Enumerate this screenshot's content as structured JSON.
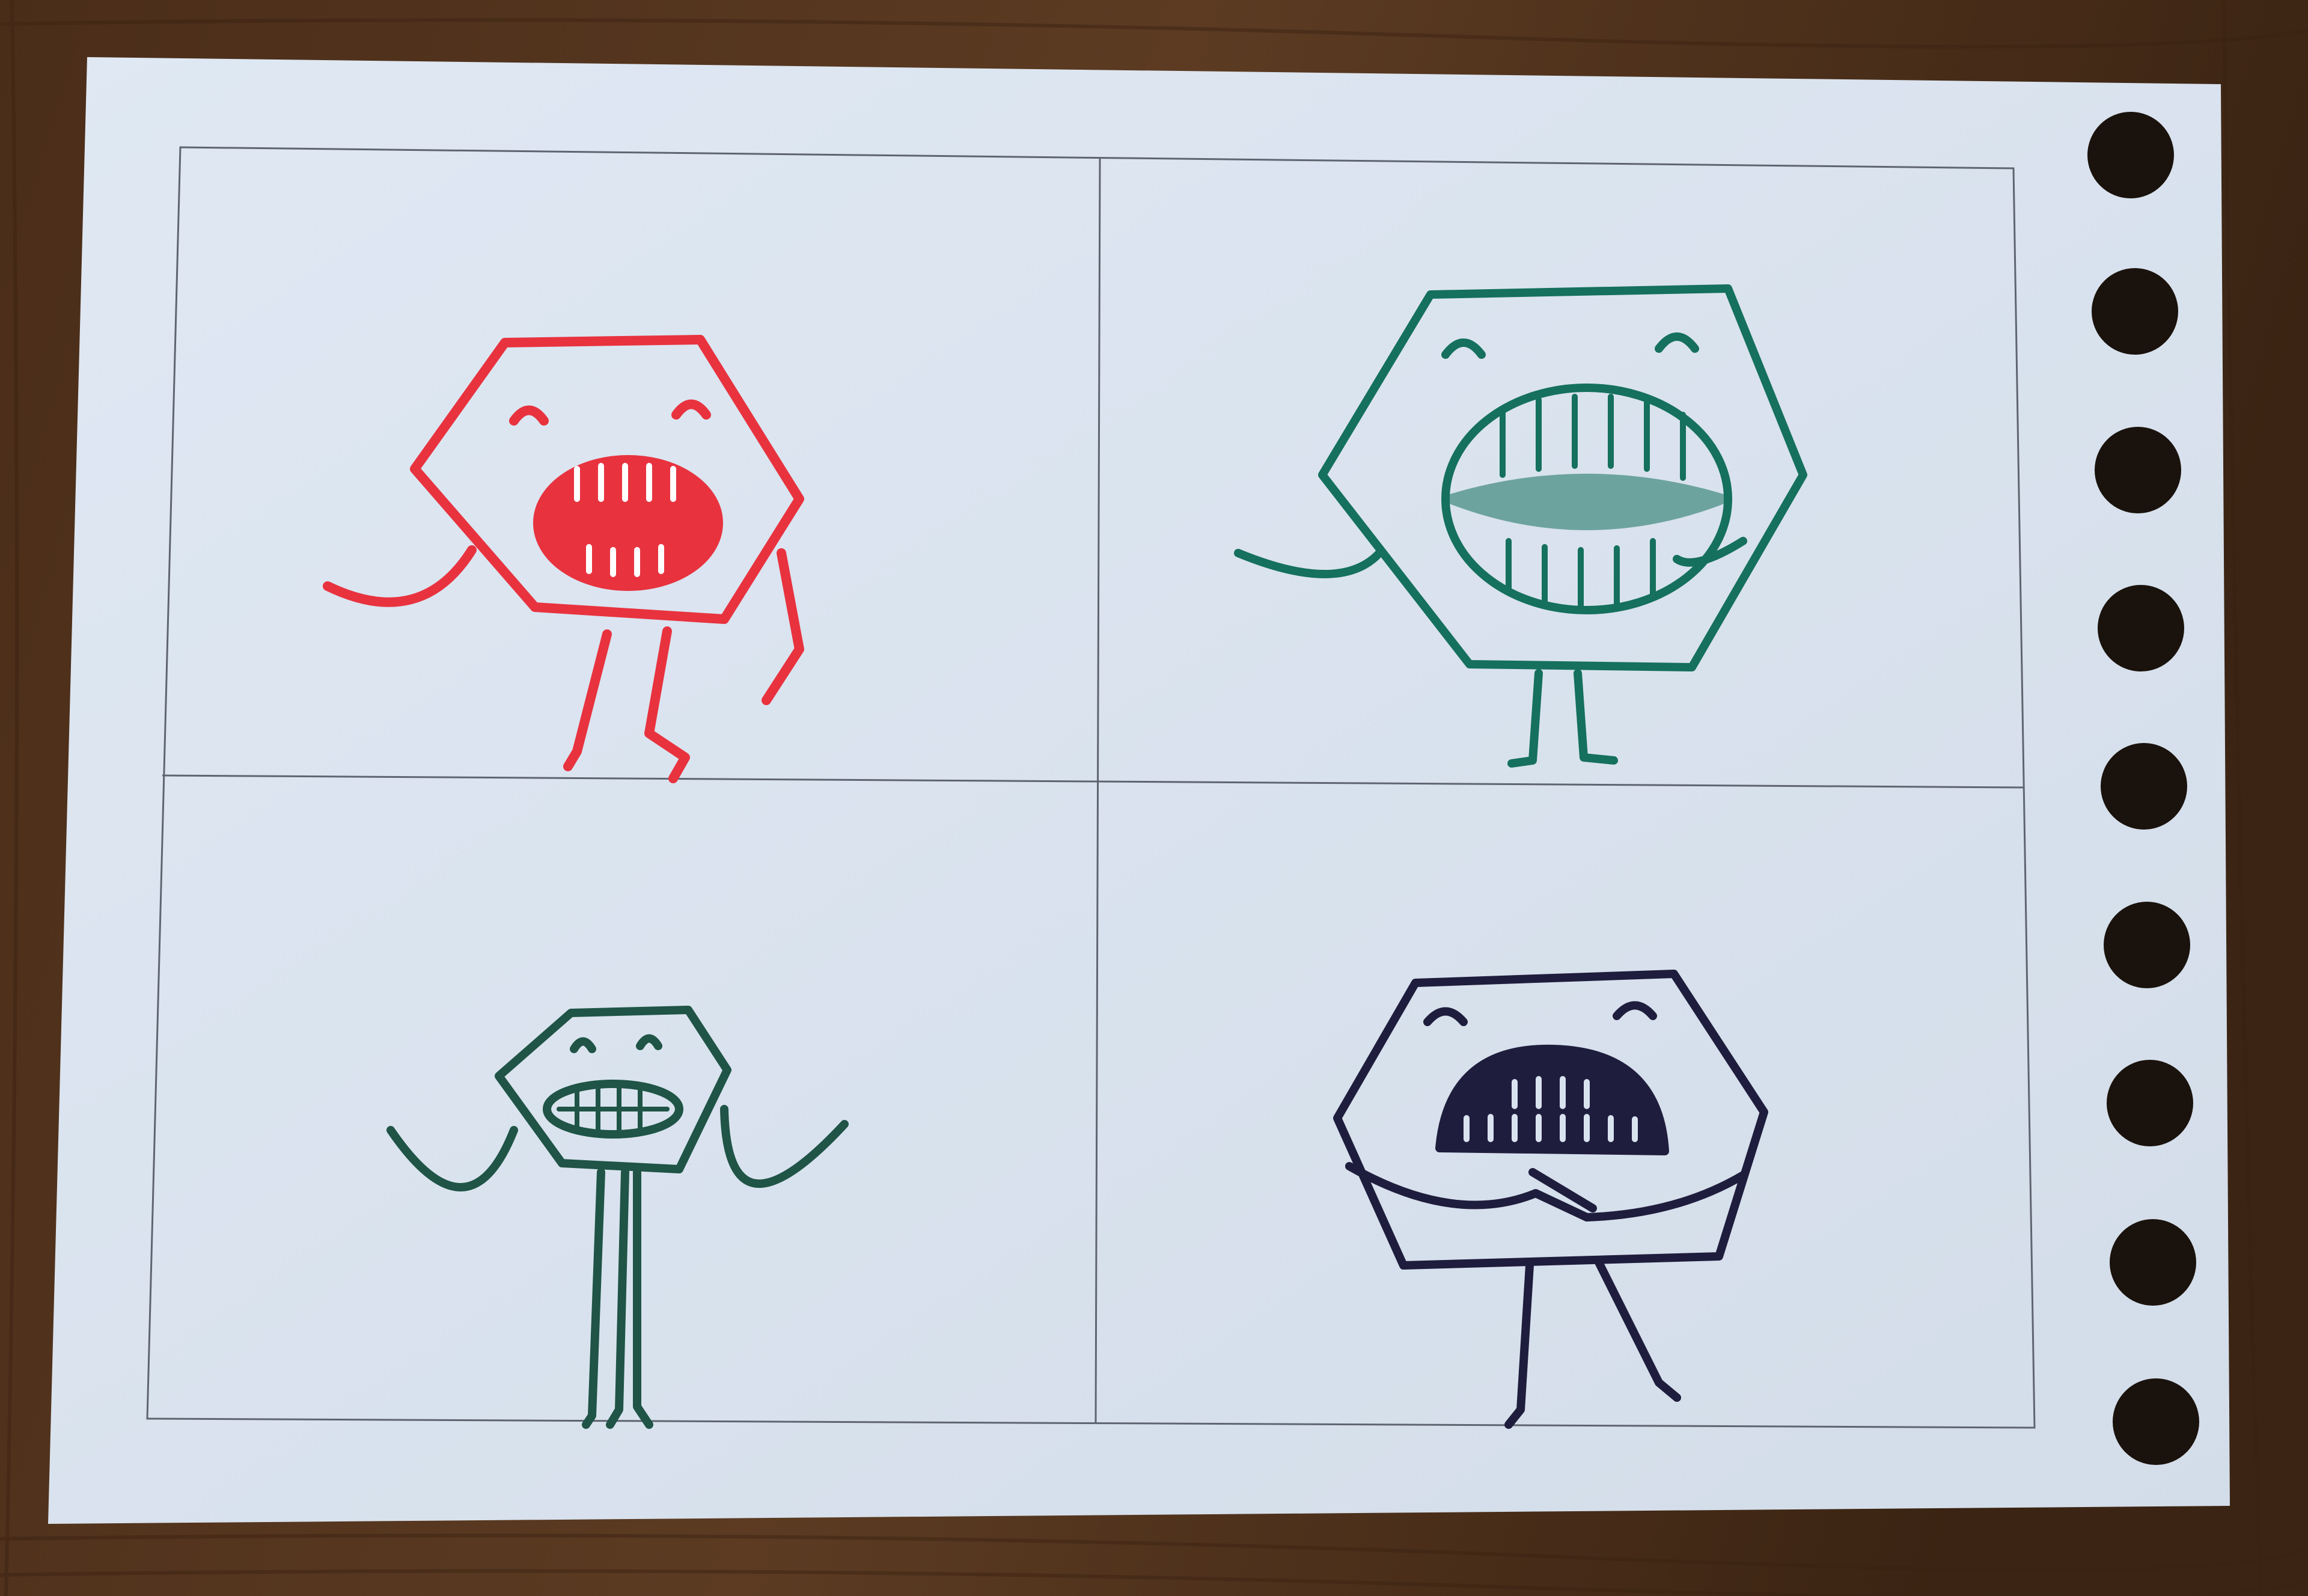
{
  "scene": {
    "background": "wooden-table",
    "object": "hole-punched-paper-sheet",
    "colors": {
      "wood_dark": "#3a2414",
      "wood_mid": "#5a3a22",
      "paper": "#d9e3ef",
      "grid_line": "#5f6570",
      "hole": "#1a120c"
    }
  },
  "panels": [
    {
      "position": "top-left",
      "character": "red-hexagon-monster",
      "color": "#e8333f",
      "mouth": "open-lips-teeth"
    },
    {
      "position": "top-right",
      "character": "teal-hexagon-monster",
      "color": "#15705d",
      "mouth": "big-round-teeth"
    },
    {
      "position": "bottom-left",
      "character": "dark-green-hexagon-monster",
      "color": "#1f5446",
      "mouth": "grin-teeth"
    },
    {
      "position": "bottom-right",
      "character": "navy-hexagon-monster",
      "color": "#1f1d3d",
      "mouth": "frown-teeth"
    }
  ],
  "binder_holes": {
    "count": 9
  }
}
